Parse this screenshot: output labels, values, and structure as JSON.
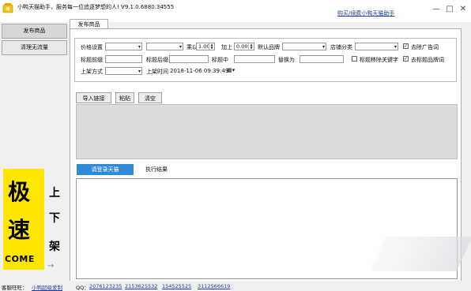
{
  "window": {
    "title": "小鸭天猫助手，服务每一位追逐梦想的人! V9.1.0.6880.34555",
    "top_link": "购买/续费小鸭天猫助手",
    "minimize": "—",
    "maximize": "□",
    "close": "✕"
  },
  "sidebar": {
    "items": [
      {
        "label": "发布商品"
      },
      {
        "label": "清理无流量"
      }
    ]
  },
  "ad": {
    "char1": "极",
    "char2": "速",
    "come": "COME",
    "side1": "上",
    "side2": "下",
    "side3": "架",
    "arrow": "→"
  },
  "main": {
    "tab_label": "发布商品",
    "settings": {
      "price_label": "价格设置",
      "multiply_label": "乘以",
      "multiply_value": "1.00",
      "plus_label": "加上",
      "plus_value": "0.00",
      "default_brand_label": "默认品牌",
      "shop_category_label": "店铺分类",
      "remove_ad_words": "去除广告词",
      "title_prefix_label": "标题前缀",
      "title_suffix_label": "标题后缀",
      "title_middle_label": "标题中",
      "replace_label": "替换为",
      "title_remove_keywords": "标题移除关键字",
      "remove_title_brand": "去标题品牌词",
      "listing_mode_label": "上架方式",
      "listing_time_label": "上架时间",
      "listing_time_value": "2018-11-06 09:39:49"
    },
    "buttons": {
      "import": "导入链接",
      "paste": "粘贴",
      "clear": "清空"
    },
    "login_button": "请登录天猫",
    "result_tab": "执行结果"
  },
  "status": {
    "wangwang_label": "客服旺旺：",
    "wangwang_name": "小鸭超级爱制",
    "qq_label": "QQ：",
    "qq_numbers": [
      "2076123235",
      "2153625532",
      "154525525",
      "3112566619"
    ]
  },
  "colors": {
    "accent": "#2f8bd8",
    "link": "#1f3f9f",
    "ad_yellow": "#ffe600"
  }
}
